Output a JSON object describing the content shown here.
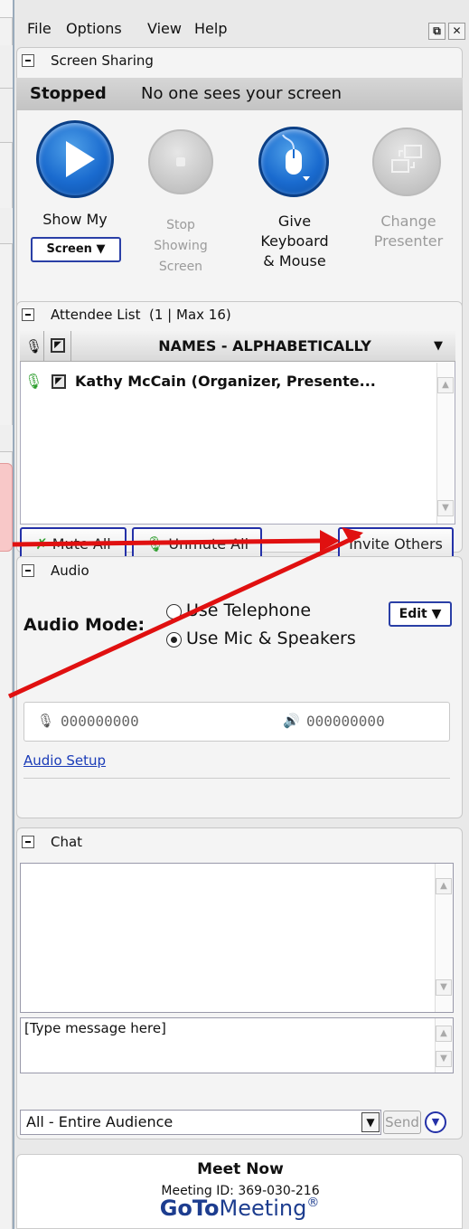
{
  "menu": {
    "file": "File",
    "options": "Options",
    "view": "View",
    "help": "Help"
  },
  "screen_sharing": {
    "title": "Screen Sharing",
    "status_state": "Stopped",
    "status_text": "No one sees your screen",
    "show_my": "Show My",
    "screen_select": "Screen",
    "stop_showing": [
      "Stop",
      "Showing",
      "Screen"
    ],
    "give_control": [
      "Give",
      "Keyboard",
      "& Mouse"
    ],
    "change_presenter": [
      "Change",
      "Presenter"
    ]
  },
  "attendees": {
    "title": "Attendee List",
    "count": "(1 | Max 16)",
    "column_header": "NAMES - ALPHABETICALLY",
    "rows": [
      {
        "name": "Kathy McCain (Organizer, Presente..."
      }
    ],
    "mute_all": "Mute All",
    "unmute_all": "Unmute All",
    "invite_others": "Invite Others"
  },
  "audio": {
    "title": "Audio",
    "mode_label": "Audio Mode:",
    "option_telephone": "Use Telephone",
    "option_mic": "Use Mic & Speakers",
    "selected": "Use Mic & Speakers",
    "edit": "Edit",
    "mic_level": "000000000",
    "speaker_level": "000000000",
    "setup_link": "Audio Setup"
  },
  "chat": {
    "title": "Chat",
    "input_placeholder": "[Type message here]",
    "recipient": "All - Entire Audience",
    "send": "Send"
  },
  "footer": {
    "meet_now": "Meet Now",
    "meeting_id": "Meeting ID: 369-030-216",
    "brand_bold": "GoTo",
    "brand_light": "Meeting",
    "brand_mark": "®"
  },
  "colors": {
    "accent_blue": "#1a6bcf",
    "arrow_red": "#e01010",
    "button_border": "#2431a8",
    "mic_green": "#2e9e2e"
  }
}
